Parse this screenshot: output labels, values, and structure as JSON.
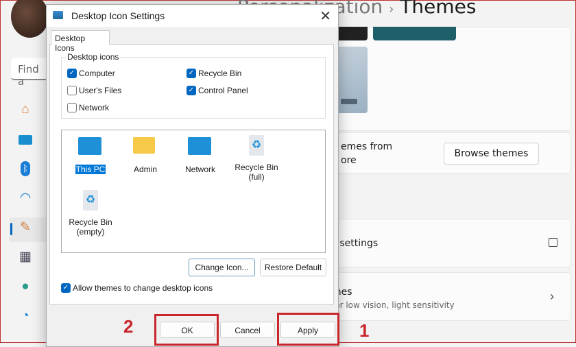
{
  "settings": {
    "breadcrumb": {
      "parent": "Personalization",
      "separator": "›",
      "current": "Themes"
    },
    "search_placeholder": "Find a",
    "nav_icons": [
      "home-icon",
      "system-icon",
      "bluetooth-icon",
      "wifi-icon",
      "personalization-icon",
      "apps-icon",
      "accounts-icon",
      "time-icon"
    ],
    "store_text_line1": "emes from",
    "store_text_line2": "ore",
    "browse_themes": "Browse themes",
    "icon_settings": "n settings",
    "contrast_title": "mes",
    "contrast_sub": "for low vision, light sensitivity"
  },
  "dialog": {
    "title": "Desktop Icon Settings",
    "tab": "Desktop Icons",
    "group_label": "Desktop icons",
    "checkboxes": [
      {
        "label": "Computer",
        "checked": true
      },
      {
        "label": "User's Files",
        "checked": false
      },
      {
        "label": "Network",
        "checked": false
      },
      {
        "label": "Recycle Bin",
        "checked": true
      },
      {
        "label": "Control Panel",
        "checked": true
      }
    ],
    "icons": [
      {
        "label": "This PC",
        "selected": true
      },
      {
        "label": "Admin"
      },
      {
        "label": "Network"
      },
      {
        "label": "Recycle Bin\n(full)"
      },
      {
        "label": "Recycle Bin\n(empty)"
      }
    ],
    "change_icon": "Change Icon...",
    "restore_default": "Restore Default",
    "allow_themes": {
      "label": "Allow themes to change desktop icons",
      "checked": true
    },
    "ok": "OK",
    "cancel": "Cancel",
    "apply": "Apply"
  },
  "annotations": {
    "step1": "1",
    "step2": "2",
    "color": "#c9262c"
  },
  "accent": "#0067c0"
}
